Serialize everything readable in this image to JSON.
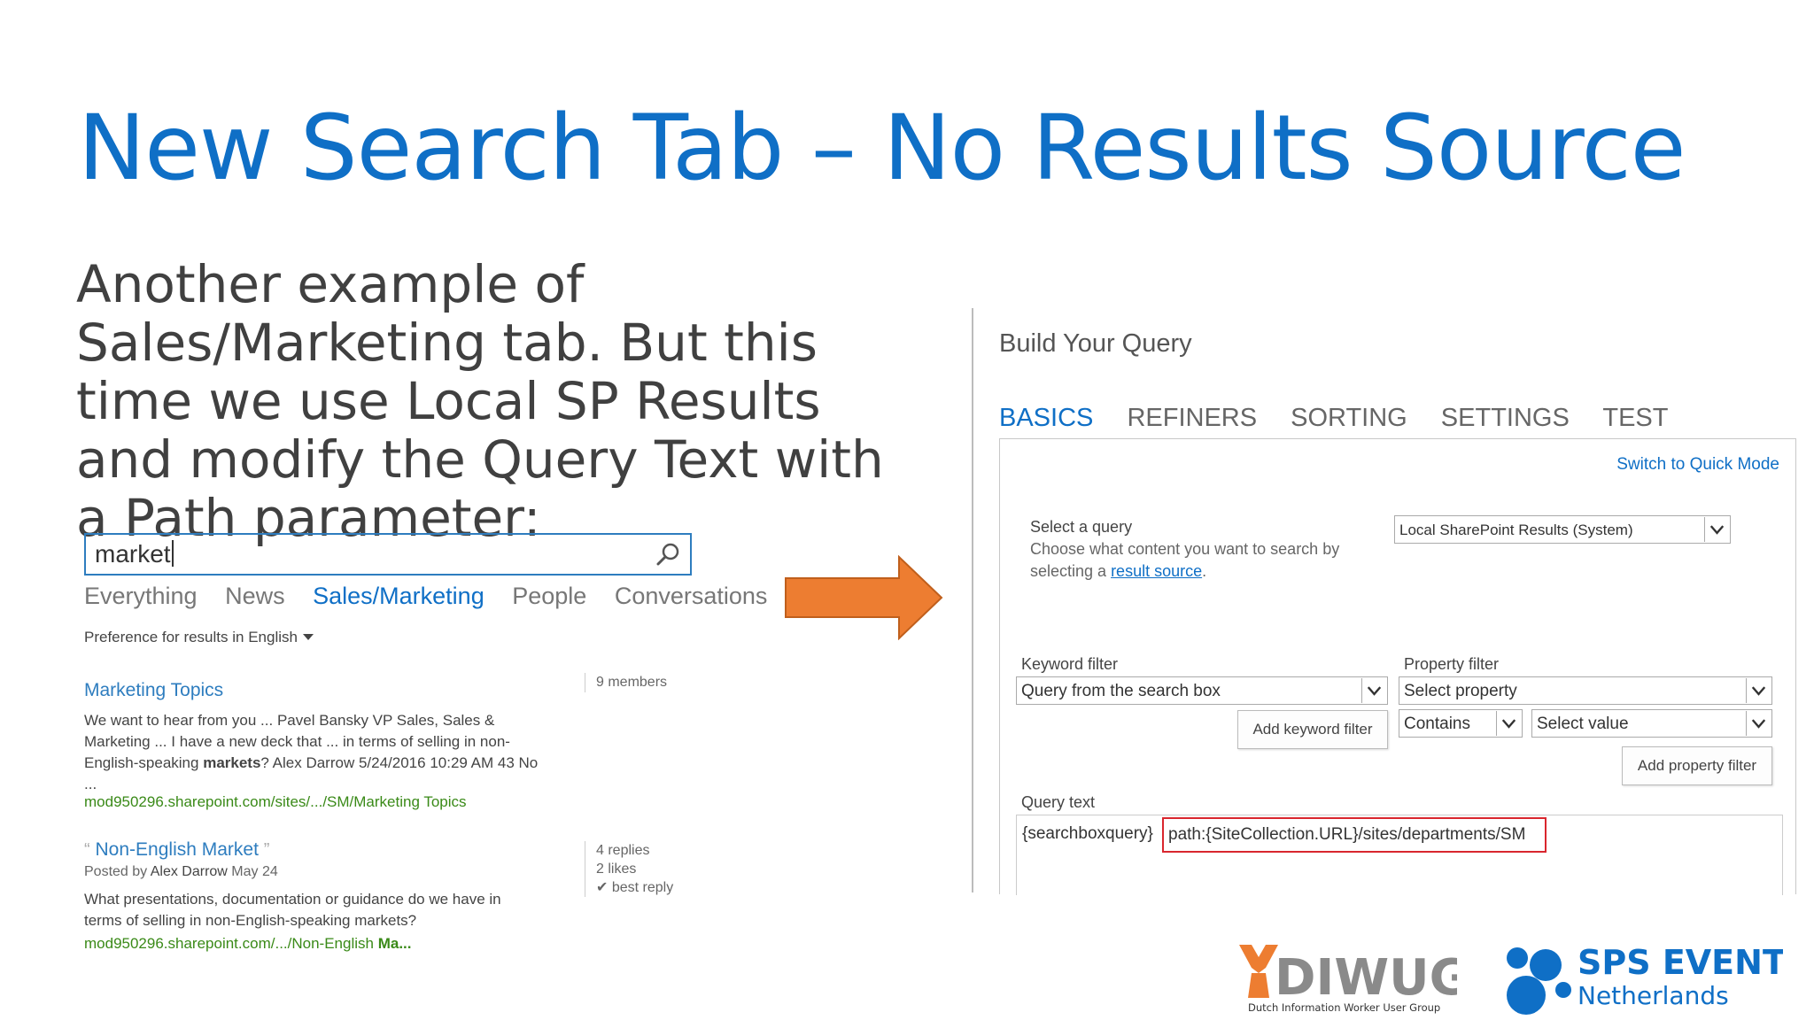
{
  "slide": {
    "title": "New Search Tab – No Results Source",
    "intro": "Another example of Sales/Marketing tab.  But this time we use Local SP Results and modify the Query Text with a Path parameter:"
  },
  "search": {
    "value": "market",
    "tabs": [
      "Everything",
      "News",
      "Sales/Marketing",
      "People",
      "Conversations",
      "..."
    ],
    "active_tab": "Sales/Marketing",
    "preference": "Preference for results in English"
  },
  "results": [
    {
      "title": "Marketing Topics",
      "body_lines": [
        "We want to hear from you ... Pavel Bansky VP Sales, Sales &",
        "Marketing ... I have a new deck that ... in terms of selling in non-",
        "English-speaking ",
        "markets",
        "? Alex Darrow 5/24/2016 10:29 AM 43 No",
        "..."
      ],
      "url": "mod950296.sharepoint.com/sites/.../SM/Marketing Topics",
      "meta": [
        "9 members"
      ]
    },
    {
      "title_prefix": "Non-English ",
      "title_bold": "Market",
      "posted_by_label": "Posted by ",
      "posted_by": "Alex Darrow",
      "posted_date": " May 24",
      "body_lines": [
        "What presentations, documentation or guidance do we have in",
        "terms of selling in non-English-speaking markets?"
      ],
      "url_prefix": "mod950296.sharepoint.com/.../Non-English ",
      "url_bold": "Ma...",
      "meta": [
        "4 replies",
        "2 likes",
        "best reply"
      ]
    }
  ],
  "panel": {
    "title": "Build Your Query",
    "tabs": [
      "BASICS",
      "REFINERS",
      "SORTING",
      "SETTINGS",
      "TEST"
    ],
    "active_tab": "BASICS",
    "quick_mode": "Switch to Quick Mode",
    "select_query_label": "Select a query",
    "select_query_desc_1": "Choose what content you want to search by",
    "select_query_desc_2": "selecting a ",
    "result_source_link": "result source",
    "select_query_value": "Local SharePoint Results (System)",
    "keyword_filter_label": "Keyword filter",
    "keyword_filter_value": "Query from the search box",
    "add_keyword_filter": "Add keyword filter",
    "property_filter_label": "Property filter",
    "property_value": "Select property",
    "operator_value": "Contains",
    "value_select": "Select value",
    "add_property_filter": "Add property filter",
    "query_text_label": "Query text",
    "query_text_part1": "{searchboxquery}",
    "query_text_part2": "path:{SiteCollection.URL}/sites/departments/SM"
  },
  "logos": {
    "diwug_name": "DIWUG",
    "diwug_tagline": "Dutch Information Worker User Group",
    "sps_name": "SPS EVENTS",
    "sps_sub": "Netherlands"
  },
  "colors": {
    "accent_blue": "#0f6fc6",
    "link_green": "#3a8a18",
    "arrow_orange": "#ed7d31",
    "highlight_red": "#d9262e"
  }
}
